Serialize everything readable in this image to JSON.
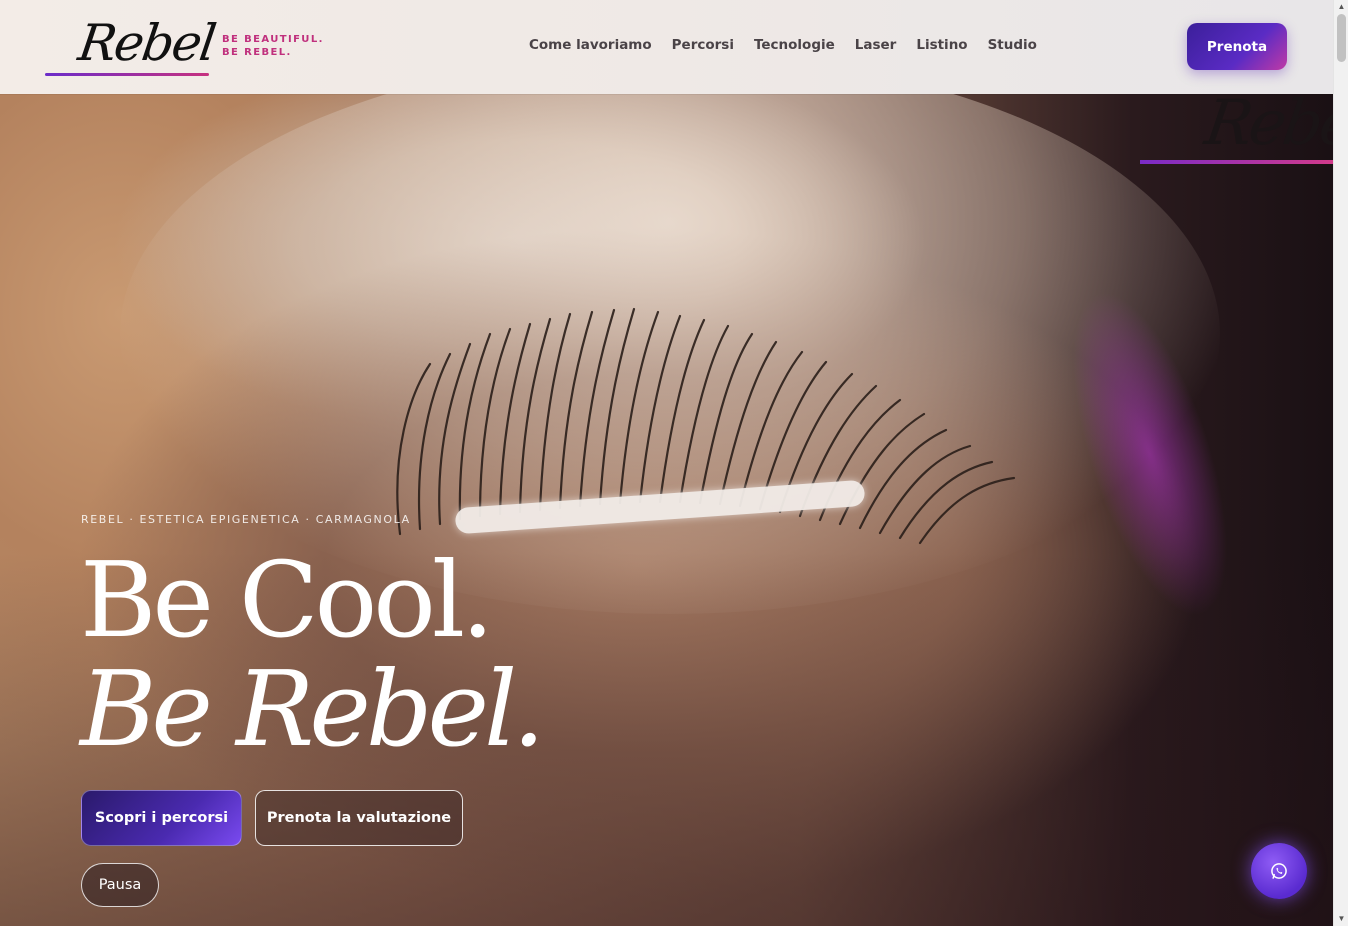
{
  "brand": {
    "logo_text": "Rebel",
    "tagline": "BE BEAUTIFUL. BE REBEL."
  },
  "nav": {
    "items": [
      {
        "label": "Come lavoriamo"
      },
      {
        "label": "Percorsi"
      },
      {
        "label": "Tecnologie"
      },
      {
        "label": "Laser"
      },
      {
        "label": "Listino"
      },
      {
        "label": "Studio"
      }
    ],
    "cta_label": "Prenota"
  },
  "hero": {
    "eyebrow": "REBEL · ESTETICA EPIGENETICA · CARMAGNOLA",
    "title_line1": "Be Cool.",
    "title_line2": "Be Rebel.",
    "primary_button": "Scopri i percorsi",
    "secondary_button": "Prenota la valutazione",
    "pause_button": "Pausa"
  },
  "colors": {
    "accent_purple": "#5a2bc4",
    "accent_pink": "#c0307d",
    "header_bg": "#efe9e6"
  },
  "icons": {
    "whatsapp": "whatsapp-icon",
    "scroll_up": "scroll-up-arrow",
    "scroll_down": "scroll-down-arrow"
  }
}
